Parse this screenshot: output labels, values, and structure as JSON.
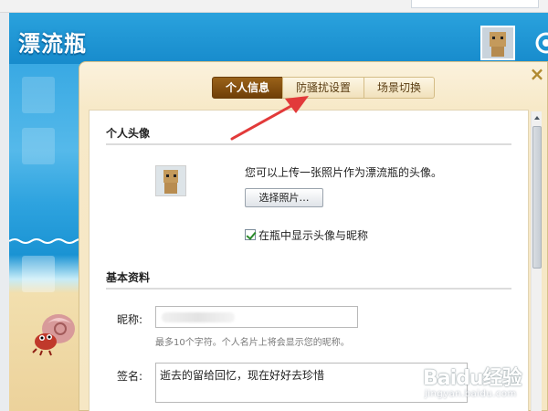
{
  "app": {
    "logo_text": "漂流瓶"
  },
  "dialog": {
    "tabs": [
      {
        "label": "个人信息",
        "active": true
      },
      {
        "label": "防骚扰设置",
        "active": false
      },
      {
        "label": "场景切换",
        "active": false
      }
    ],
    "close_glyph": "×"
  },
  "avatar_section": {
    "title": "个人头像",
    "hint": "您可以上传一张照片作为漂流瓶的头像。",
    "choose_button": "选择照片…",
    "show_checkbox_label": "在瓶中显示头像与昵称",
    "show_checkbox_checked": true
  },
  "profile_section": {
    "title": "基本资料",
    "nickname_label": "昵称:",
    "nickname_hint": "最多10个字符。个人名片上将会显示您的昵称。",
    "signature_label": "签名:",
    "signature_value": "逝去的留给回忆，现在好好去珍惜"
  },
  "watermark": {
    "brand": "Baidu经验",
    "url": "jingyan.baidu.com"
  },
  "colors": {
    "header_blue": "#1f97d6",
    "tab_active": "#7a480d",
    "annotation_red": "#e23a3a"
  }
}
